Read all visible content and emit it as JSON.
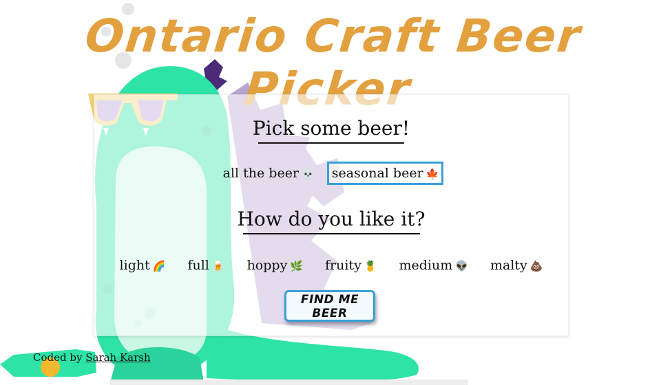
{
  "page": {
    "title": "Ontario Craft Beer Picker"
  },
  "card": {
    "heading1": "Pick some beer!",
    "scope_options": [
      {
        "label": "all the beer",
        "emoji": "💀",
        "selected": false
      },
      {
        "label": "seasonal beer",
        "emoji": "🍁",
        "selected": true
      }
    ],
    "heading2": "How do you like it?",
    "style_options": [
      {
        "label": "light",
        "emoji": "🌈"
      },
      {
        "label": "full",
        "emoji": "🍺"
      },
      {
        "label": "hoppy",
        "emoji": "🌿"
      },
      {
        "label": "fruity",
        "emoji": "🍍"
      },
      {
        "label": "medium",
        "emoji": "👽"
      },
      {
        "label": "malty",
        "emoji": "💩"
      }
    ],
    "find_button": "FIND ME BEER"
  },
  "footer": {
    "prefix": "Coded by",
    "author": "Sarah Karsh"
  },
  "colors": {
    "title": "#e3a03e",
    "selection_border": "#3a9fd6",
    "monster": "#2de3a6",
    "spikes": "#b7a3cf"
  },
  "icons": [
    "sunglasses-icon",
    "monster-illustration",
    "bottle-icon"
  ]
}
